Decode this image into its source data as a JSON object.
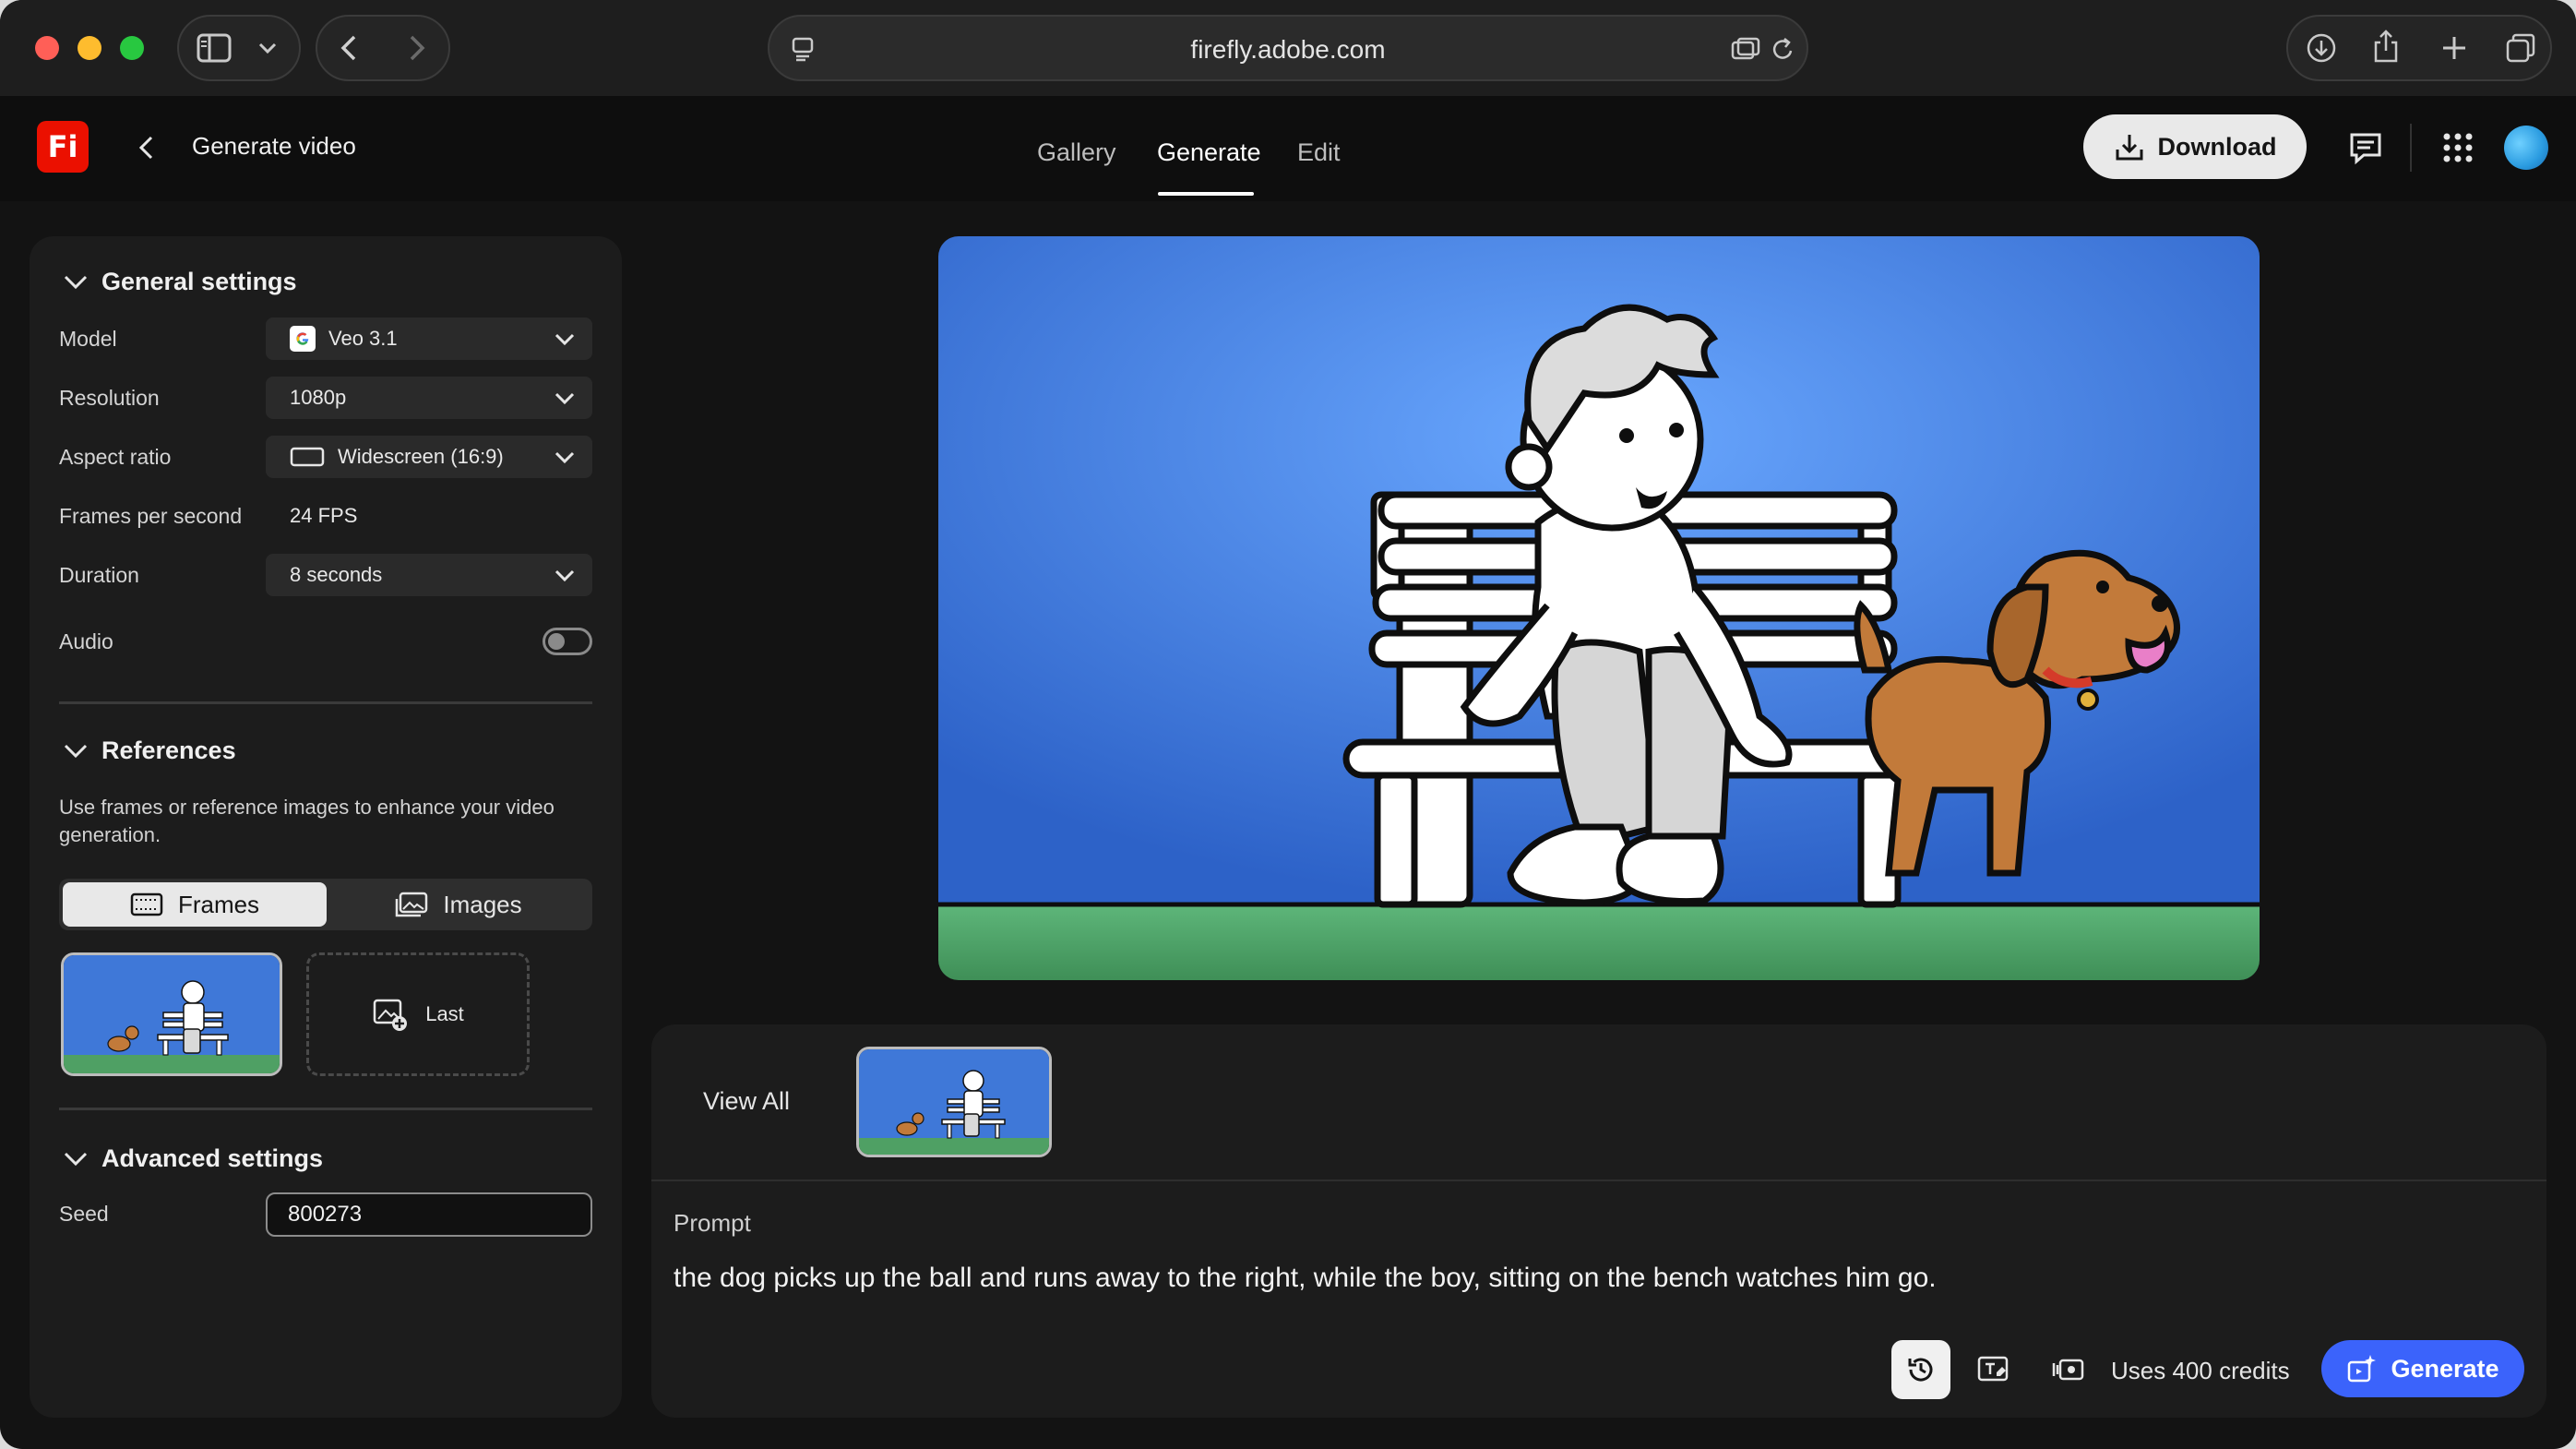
{
  "browser": {
    "url": "firefly.adobe.com",
    "colors": {
      "close": "#ff5f57",
      "minimize": "#febc2e",
      "maximize": "#28c840"
    }
  },
  "app": {
    "logo_text": "Fi",
    "page_title": "Generate video",
    "tabs": [
      {
        "label": "Gallery",
        "active": false
      },
      {
        "label": "Generate",
        "active": true
      },
      {
        "label": "Edit",
        "active": false
      }
    ],
    "download_label": "Download"
  },
  "general_settings": {
    "title": "General settings",
    "model": {
      "label": "Model",
      "value": "Veo 3.1",
      "icon": "google-icon"
    },
    "resolution": {
      "label": "Resolution",
      "value": "1080p"
    },
    "aspect_ratio": {
      "label": "Aspect ratio",
      "value": "Widescreen (16:9)",
      "icon": "widescreen-icon"
    },
    "fps": {
      "label": "Frames per second",
      "value": "24 FPS"
    },
    "duration": {
      "label": "Duration",
      "value": "8 seconds"
    },
    "audio": {
      "label": "Audio",
      "enabled": false
    }
  },
  "references": {
    "title": "References",
    "help": "Use frames or reference images to enhance your video generation.",
    "segments": [
      {
        "label": "Frames",
        "active": true
      },
      {
        "label": "Images",
        "active": false
      }
    ],
    "last_label": "Last"
  },
  "advanced_settings": {
    "title": "Advanced settings",
    "seed_label": "Seed",
    "seed_value": "800273"
  },
  "history": {
    "view_all": "View All"
  },
  "prompt": {
    "label": "Prompt",
    "text": "the dog picks up the ball and runs away to the right, while the boy, sitting on the bench watches him go.",
    "credits": "Uses 400 credits",
    "generate_label": "Generate"
  },
  "colors": {
    "accent": "#3b63fb",
    "brand": "#eb1000",
    "sky": "#3f78d8",
    "grass": "#4fa064"
  }
}
